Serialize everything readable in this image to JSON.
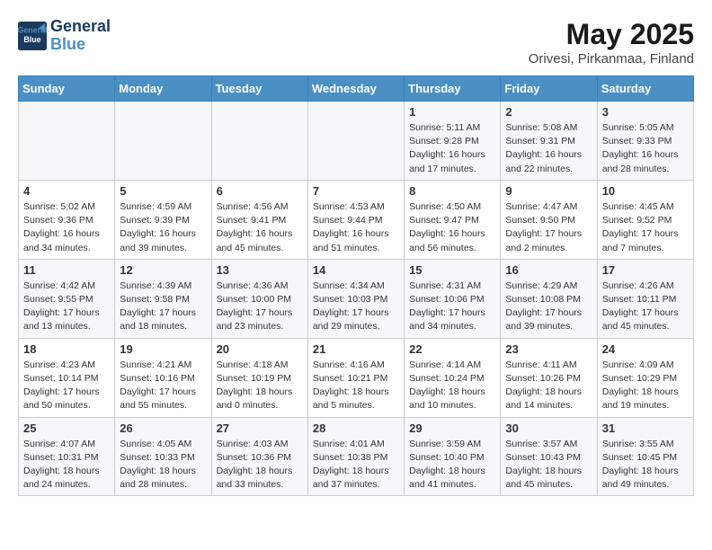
{
  "logo": {
    "line1": "General",
    "line2": "Blue"
  },
  "title": "May 2025",
  "subtitle": "Orivesi, Pirkanmaa, Finland",
  "days_of_week": [
    "Sunday",
    "Monday",
    "Tuesday",
    "Wednesday",
    "Thursday",
    "Friday",
    "Saturday"
  ],
  "weeks": [
    [
      {
        "day": "",
        "info": ""
      },
      {
        "day": "",
        "info": ""
      },
      {
        "day": "",
        "info": ""
      },
      {
        "day": "",
        "info": ""
      },
      {
        "day": "1",
        "info": "Sunrise: 5:11 AM\nSunset: 9:28 PM\nDaylight: 16 hours\nand 17 minutes."
      },
      {
        "day": "2",
        "info": "Sunrise: 5:08 AM\nSunset: 9:31 PM\nDaylight: 16 hours\nand 22 minutes."
      },
      {
        "day": "3",
        "info": "Sunrise: 5:05 AM\nSunset: 9:33 PM\nDaylight: 16 hours\nand 28 minutes."
      }
    ],
    [
      {
        "day": "4",
        "info": "Sunrise: 5:02 AM\nSunset: 9:36 PM\nDaylight: 16 hours\nand 34 minutes."
      },
      {
        "day": "5",
        "info": "Sunrise: 4:59 AM\nSunset: 9:39 PM\nDaylight: 16 hours\nand 39 minutes."
      },
      {
        "day": "6",
        "info": "Sunrise: 4:56 AM\nSunset: 9:41 PM\nDaylight: 16 hours\nand 45 minutes."
      },
      {
        "day": "7",
        "info": "Sunrise: 4:53 AM\nSunset: 9:44 PM\nDaylight: 16 hours\nand 51 minutes."
      },
      {
        "day": "8",
        "info": "Sunrise: 4:50 AM\nSunset: 9:47 PM\nDaylight: 16 hours\nand 56 minutes."
      },
      {
        "day": "9",
        "info": "Sunrise: 4:47 AM\nSunset: 9:50 PM\nDaylight: 17 hours\nand 2 minutes."
      },
      {
        "day": "10",
        "info": "Sunrise: 4:45 AM\nSunset: 9:52 PM\nDaylight: 17 hours\nand 7 minutes."
      }
    ],
    [
      {
        "day": "11",
        "info": "Sunrise: 4:42 AM\nSunset: 9:55 PM\nDaylight: 17 hours\nand 13 minutes."
      },
      {
        "day": "12",
        "info": "Sunrise: 4:39 AM\nSunset: 9:58 PM\nDaylight: 17 hours\nand 18 minutes."
      },
      {
        "day": "13",
        "info": "Sunrise: 4:36 AM\nSunset: 10:00 PM\nDaylight: 17 hours\nand 23 minutes."
      },
      {
        "day": "14",
        "info": "Sunrise: 4:34 AM\nSunset: 10:03 PM\nDaylight: 17 hours\nand 29 minutes."
      },
      {
        "day": "15",
        "info": "Sunrise: 4:31 AM\nSunset: 10:06 PM\nDaylight: 17 hours\nand 34 minutes."
      },
      {
        "day": "16",
        "info": "Sunrise: 4:29 AM\nSunset: 10:08 PM\nDaylight: 17 hours\nand 39 minutes."
      },
      {
        "day": "17",
        "info": "Sunrise: 4:26 AM\nSunset: 10:11 PM\nDaylight: 17 hours\nand 45 minutes."
      }
    ],
    [
      {
        "day": "18",
        "info": "Sunrise: 4:23 AM\nSunset: 10:14 PM\nDaylight: 17 hours\nand 50 minutes."
      },
      {
        "day": "19",
        "info": "Sunrise: 4:21 AM\nSunset: 10:16 PM\nDaylight: 17 hours\nand 55 minutes."
      },
      {
        "day": "20",
        "info": "Sunrise: 4:18 AM\nSunset: 10:19 PM\nDaylight: 18 hours\nand 0 minutes."
      },
      {
        "day": "21",
        "info": "Sunrise: 4:16 AM\nSunset: 10:21 PM\nDaylight: 18 hours\nand 5 minutes."
      },
      {
        "day": "22",
        "info": "Sunrise: 4:14 AM\nSunset: 10:24 PM\nDaylight: 18 hours\nand 10 minutes."
      },
      {
        "day": "23",
        "info": "Sunrise: 4:11 AM\nSunset: 10:26 PM\nDaylight: 18 hours\nand 14 minutes."
      },
      {
        "day": "24",
        "info": "Sunrise: 4:09 AM\nSunset: 10:29 PM\nDaylight: 18 hours\nand 19 minutes."
      }
    ],
    [
      {
        "day": "25",
        "info": "Sunrise: 4:07 AM\nSunset: 10:31 PM\nDaylight: 18 hours\nand 24 minutes."
      },
      {
        "day": "26",
        "info": "Sunrise: 4:05 AM\nSunset: 10:33 PM\nDaylight: 18 hours\nand 28 minutes."
      },
      {
        "day": "27",
        "info": "Sunrise: 4:03 AM\nSunset: 10:36 PM\nDaylight: 18 hours\nand 33 minutes."
      },
      {
        "day": "28",
        "info": "Sunrise: 4:01 AM\nSunset: 10:38 PM\nDaylight: 18 hours\nand 37 minutes."
      },
      {
        "day": "29",
        "info": "Sunrise: 3:59 AM\nSunset: 10:40 PM\nDaylight: 18 hours\nand 41 minutes."
      },
      {
        "day": "30",
        "info": "Sunrise: 3:57 AM\nSunset: 10:43 PM\nDaylight: 18 hours\nand 45 minutes."
      },
      {
        "day": "31",
        "info": "Sunrise: 3:55 AM\nSunset: 10:45 PM\nDaylight: 18 hours\nand 49 minutes."
      }
    ]
  ]
}
